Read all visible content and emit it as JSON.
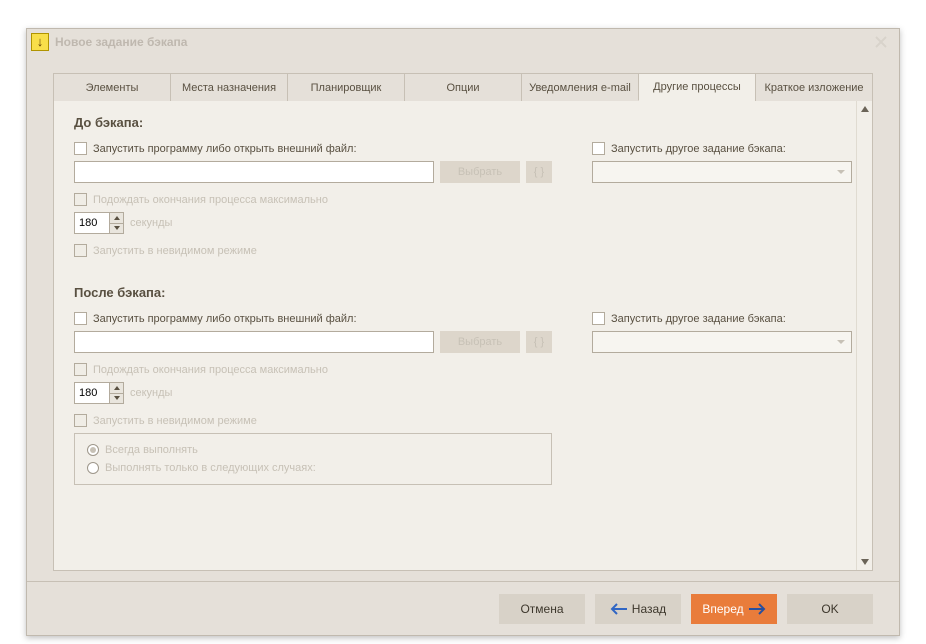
{
  "window": {
    "title": "Новое задание бэкапа"
  },
  "tabs": [
    "Элементы",
    "Места назначения",
    "Планировщик",
    "Опции",
    "Уведомления e-mail",
    "Другие процессы",
    "Краткое изложение"
  ],
  "active_tab": 5,
  "sections": {
    "before": {
      "title": "До бэкапа:",
      "run_program_label": "Запустить программу либо открыть внешний файл:",
      "select_btn": "Выбрать",
      "wait_label": "Подождать окончания процесса максимально",
      "wait_value": "180",
      "wait_unit": "секунды",
      "invisible_label": "Запустить в невидимом режиме",
      "run_other_label": "Запустить другое задание бэкапа:"
    },
    "after": {
      "title": "После бэкапа:",
      "run_program_label": "Запустить программу либо открыть внешний файл:",
      "select_btn": "Выбрать",
      "wait_label": "Подождать окончания процесса максимально",
      "wait_value": "180",
      "wait_unit": "секунды",
      "invisible_label": "Запустить в невидимом режиме",
      "run_other_label": "Запустить другое задание бэкапа:",
      "radio_always": "Всегда выполнять",
      "radio_cond": "Выполнять только в следующих случаях:"
    }
  },
  "footer": {
    "cancel": "Отмена",
    "back": "Назад",
    "next": "Вперед",
    "ok": "OK"
  }
}
